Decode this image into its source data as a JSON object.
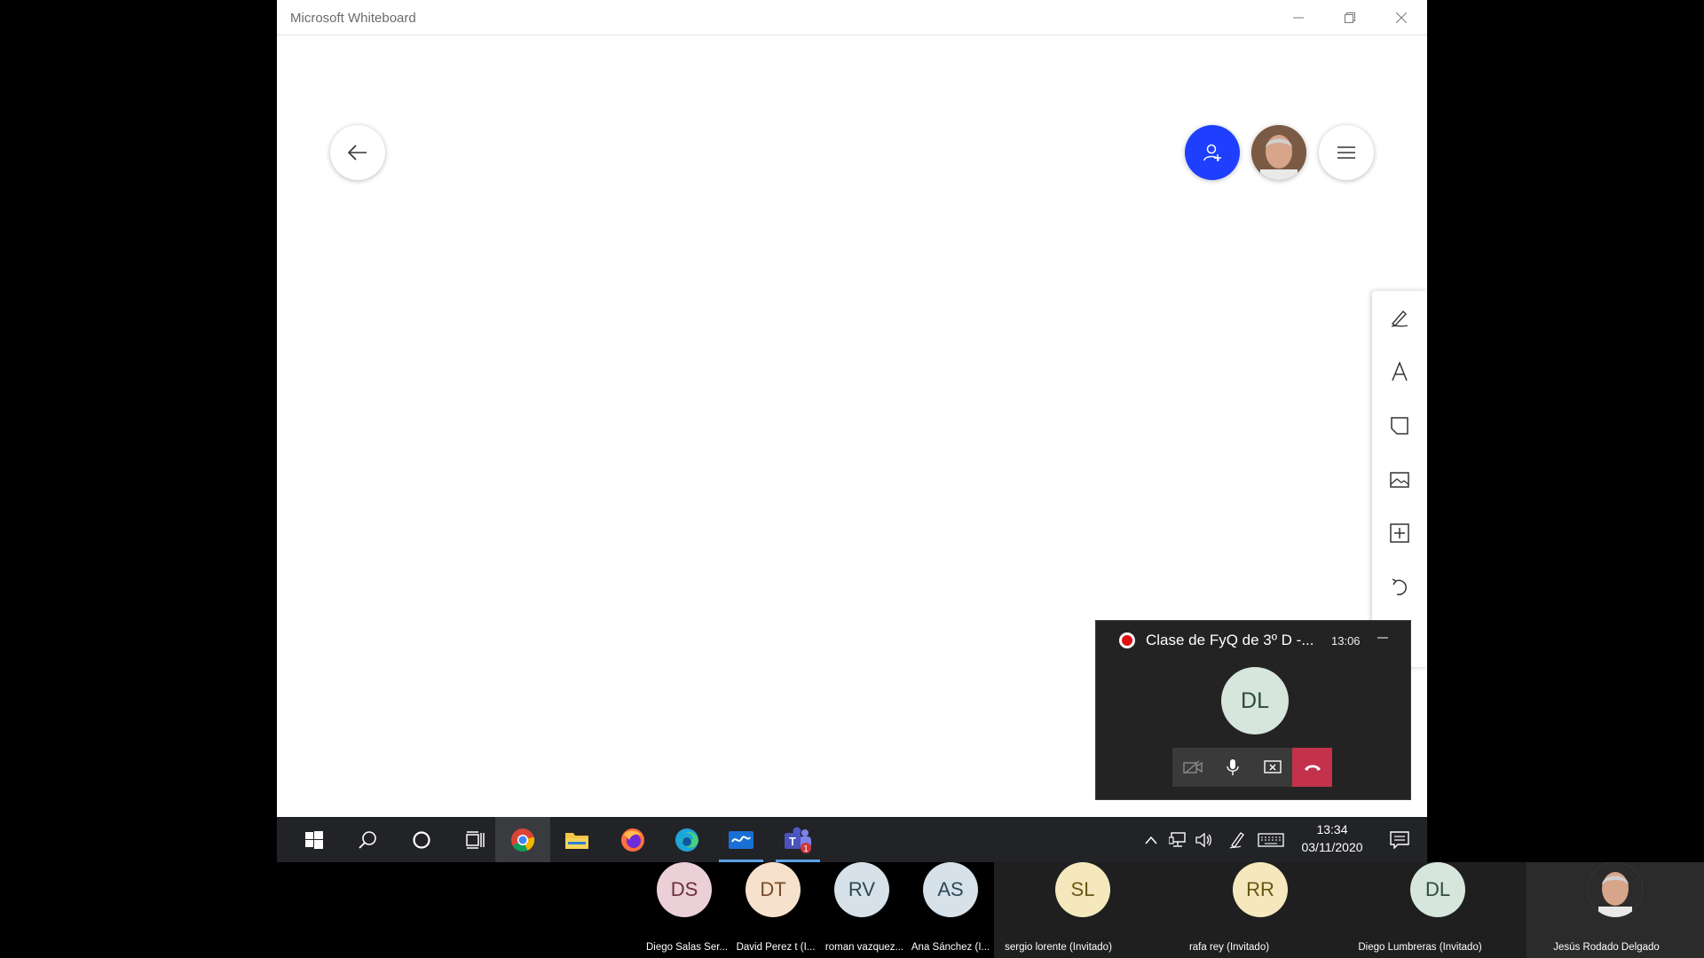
{
  "window": {
    "title": "Microsoft Whiteboard",
    "minimize_icon": "minimize-icon",
    "maximize_icon": "restore-icon",
    "close_icon": "close-icon"
  },
  "whiteboard": {
    "back_icon": "arrow-left-icon",
    "invite_icon": "add-person-icon",
    "menu_icon": "hamburger-menu-icon",
    "invite_color": "#1f3fff",
    "tools": [
      "pen-icon",
      "text-icon",
      "sticky-note-icon",
      "image-icon",
      "add-icon",
      "undo-icon"
    ]
  },
  "call": {
    "title": "Clase de FyQ de 3º D -...",
    "time": "13:06",
    "avatar_initials": "DL",
    "controls": [
      "camera-off-icon",
      "microphone-icon",
      "share-screen-icon",
      "hang-up-icon"
    ],
    "hangup_color": "#c4314b"
  },
  "taskbar": {
    "clock_time": "13:34",
    "clock_date": "03/11/2020",
    "apps": [
      "windows-start-icon",
      "search-icon",
      "cortana-icon",
      "task-view-icon",
      "chrome-icon",
      "file-explorer-icon",
      "firefox-icon",
      "edge-icon",
      "whiteboard-icon",
      "teams-icon"
    ],
    "teams_badge": "1"
  },
  "participants": [
    {
      "initials": "DS",
      "name": "Diego Salas Ser...",
      "bg": "#ecd0d8",
      "fg": "#6b2e40"
    },
    {
      "initials": "DT",
      "name": "David Perez t (I...",
      "bg": "#f6e1cd",
      "fg": "#7a4a21"
    },
    {
      "initials": "RV",
      "name": "roman vazquez...",
      "bg": "#d6e1e9",
      "fg": "#2e4757"
    },
    {
      "initials": "AS",
      "name": "Ana Sánchez (I...",
      "bg": "#d6e1e9",
      "fg": "#2e4757"
    },
    {
      "initials": "SL",
      "name": "sergio lorente (Invitado)",
      "bg": "#f5e8bd",
      "fg": "#6b5514"
    },
    {
      "initials": "RR",
      "name": "rafa rey (Invitado)",
      "bg": "#f5e8bd",
      "fg": "#6b5514"
    },
    {
      "initials": "DL",
      "name": "Diego Lumbreras (Invitado)",
      "bg": "#d6e6dc",
      "fg": "#2d4b38"
    },
    {
      "initials": "",
      "name": "Jesús Rodado Delgado",
      "bg": "#c9a58c",
      "fg": "#000"
    }
  ]
}
